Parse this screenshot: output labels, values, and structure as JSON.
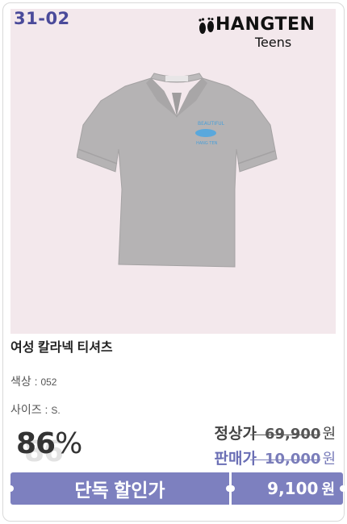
{
  "product": {
    "code": "31-02",
    "brand": {
      "name": "HANGTEN",
      "sub": "Teens"
    },
    "name": "여성 칼라넥 티셔츠",
    "color_label": "색상 : ",
    "color_value": "052",
    "size_label": "사이즈 : ",
    "size_value": "S."
  },
  "pricing": {
    "discount_number": "86",
    "discount_symbol": "%",
    "regular_label": "정상가",
    "regular_price": "69,900",
    "sale_label": "판매가",
    "sale_price": "10,000",
    "currency": "원",
    "exclusive_label": "단독 할인가",
    "final_price": "9,100",
    "final_currency": "원"
  },
  "colors": {
    "image_background": "#f3e8ec",
    "code_color": "#4a4a9a",
    "accent": "#7d80bf",
    "shirt": "#b5b3b4"
  },
  "icons": {
    "brand_logo": "footprints-logo-icon",
    "product_image": "polo-shirt-image"
  }
}
